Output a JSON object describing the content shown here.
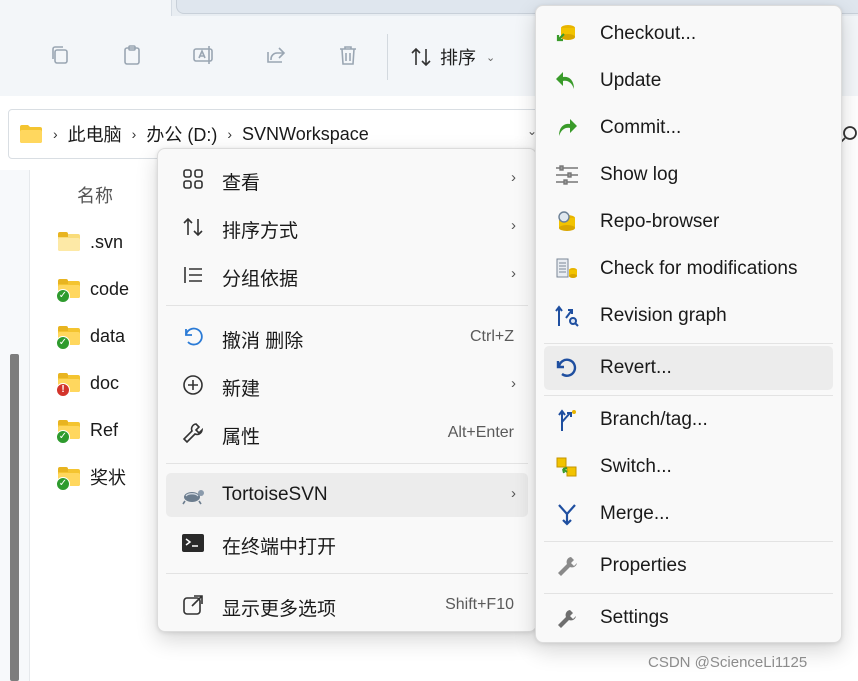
{
  "breadcrumb": [
    "此电脑",
    "办公 (D:)",
    "SVNWorkspace"
  ],
  "toolbar": {
    "sort_label": "排序"
  },
  "filelist": {
    "column_header": "名称",
    "files": [
      {
        "name": ".svn",
        "status": "none"
      },
      {
        "name": "code",
        "status": "normal"
      },
      {
        "name": "data",
        "status": "normal"
      },
      {
        "name": "doc",
        "status": "modified"
      },
      {
        "name": "Ref",
        "status": "normal"
      },
      {
        "name": "奖状",
        "status": "normal"
      }
    ]
  },
  "context_menu": {
    "items": [
      {
        "label": "查看",
        "icon": "grid-icon",
        "submenu": true
      },
      {
        "label": "排序方式",
        "icon": "sort-icon",
        "submenu": true
      },
      {
        "label": "分组依据",
        "icon": "group-icon",
        "submenu": true
      },
      {
        "label": "撤消 删除",
        "icon": "undo-icon",
        "shortcut": "Ctrl+Z"
      },
      {
        "label": "新建",
        "icon": "plus-circle-icon",
        "submenu": true
      },
      {
        "label": "属性",
        "icon": "wrench-icon",
        "shortcut": "Alt+Enter"
      },
      {
        "label": "TortoiseSVN",
        "icon": "tortoisesvn-icon",
        "submenu": true,
        "highlighted": true
      },
      {
        "label": "在终端中打开",
        "icon": "terminal-icon"
      },
      {
        "label": "显示更多选项",
        "icon": "external-icon",
        "shortcut": "Shift+F10"
      }
    ]
  },
  "svn_menu": {
    "items": [
      {
        "label": "Checkout...",
        "icon": "checkout-icon"
      },
      {
        "label": "Update",
        "icon": "update-icon"
      },
      {
        "label": "Commit...",
        "icon": "commit-icon"
      },
      {
        "label": "Show log",
        "icon": "log-icon"
      },
      {
        "label": "Repo-browser",
        "icon": "repo-browser-icon"
      },
      {
        "label": "Check for modifications",
        "icon": "check-modifications-icon"
      },
      {
        "label": "Revision graph",
        "icon": "revision-graph-icon"
      },
      {
        "label": "Revert...",
        "icon": "revert-icon",
        "highlighted": true
      },
      {
        "label": "Branch/tag...",
        "icon": "branch-icon"
      },
      {
        "label": "Switch...",
        "icon": "switch-icon"
      },
      {
        "label": "Merge...",
        "icon": "merge-icon"
      },
      {
        "label": "Properties",
        "icon": "properties-icon"
      },
      {
        "label": "Settings",
        "icon": "settings-icon"
      }
    ]
  },
  "watermark": "CSDN @ScienceLi1125",
  "colors": {
    "folder": "#ffd75e",
    "ok_overlay": "#2e9b2e",
    "modified_overlay": "#d3342b",
    "menu_bg": "#f9f9f9",
    "highlight": "#ececec"
  }
}
